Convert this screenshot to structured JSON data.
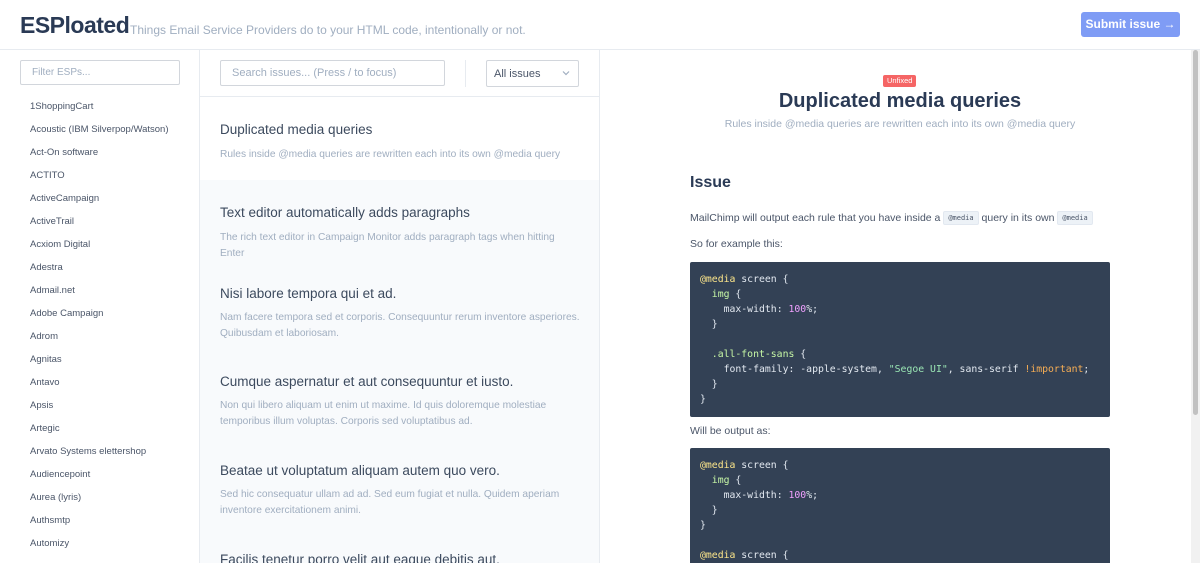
{
  "header": {
    "logo": "ESPloated",
    "tagline": "Things Email Service Providers do to your HTML code, intentionally or not.",
    "submit_label": "Submit issue →"
  },
  "sidebar": {
    "filter_placeholder": "Filter ESPs...",
    "esps": [
      "1ShoppingCart",
      "Acoustic (IBM Silverpop/Watson)",
      "Act-On software",
      "ACTITO",
      "ActiveCampaign",
      "ActiveTrail",
      "Acxiom Digital",
      "Adestra",
      "Admail.net",
      "Adobe Campaign",
      "Adrom",
      "Agnitas",
      "Antavo",
      "Apsis",
      "Artegic",
      "Arvato Systems elettershop",
      "Audiencepoint",
      "Aurea (lyris)",
      "Authsmtp",
      "Automizy"
    ]
  },
  "middle": {
    "search_placeholder": "Search issues... (Press / to focus)",
    "filter_select": "All issues",
    "issues": [
      {
        "title": "Duplicated media queries",
        "desc": "Rules inside @media queries are rewritten each into its own @media query"
      },
      {
        "title": "Text editor automatically adds paragraphs",
        "desc": "The rich text editor in Campaign Monitor adds paragraph tags when hitting Enter"
      },
      {
        "title": "Nisi labore tempora qui et ad.",
        "desc": "Nam facere tempora sed et corporis. Consequuntur rerum inventore asperiores. Quibusdam et laboriosam."
      },
      {
        "title": "Cumque aspernatur et aut consequuntur et iusto.",
        "desc": "Non qui libero aliquam ut enim ut maxime. Id quis doloremque molestiae temporibus illum voluptas. Corporis sed voluptatibus ad."
      },
      {
        "title": "Beatae ut voluptatum aliquam autem quo vero.",
        "desc": "Sed hic consequatur ullam ad ad. Sed eum fugiat et nulla. Quidem aperiam inventore exercitationem animi."
      },
      {
        "title": "Facilis tenetur porro velit aut eaque debitis aut.",
        "desc": ""
      }
    ]
  },
  "detail": {
    "badge": "Unfixed",
    "title": "Duplicated media queries",
    "subtitle": "Rules inside @media queries are rewritten each into its own @media query",
    "section_heading": "Issue",
    "para1_before": "MailChimp will output each rule that you have inside a",
    "para1_code1": "@media",
    "para1_middle": "query in its own",
    "para1_code2": "@media",
    "para2": "So for example this:",
    "para3": "Will be output as:",
    "code1": {
      "l1_kw": "@media",
      "l1_rest": " screen {",
      "l2_sel": "img",
      "l2_rest": " {",
      "l3_prop": "max-width",
      "l3_num": "100",
      "l3_rest": "%;",
      "l4": "}",
      "l6_sel": ".all-font-sans",
      "l6_rest": " {",
      "l7_prop": "font-family",
      "l7_val": ": -apple-system, ",
      "l7_str": "\"Segoe UI\"",
      "l7_val2": ", sans-serif ",
      "l7_imp": "!important",
      "l7_end": ";",
      "l8": "}",
      "l9": "}"
    },
    "code2": {
      "l1_kw": "@media",
      "l1_rest": " screen {",
      "l2_sel": "img",
      "l2_rest": " {",
      "l3_prop": "max-width",
      "l3_num": "100",
      "l3_rest": "%;",
      "l4": "}",
      "l5": "}",
      "l7_kw": "@media",
      "l7_rest": " screen {"
    }
  }
}
